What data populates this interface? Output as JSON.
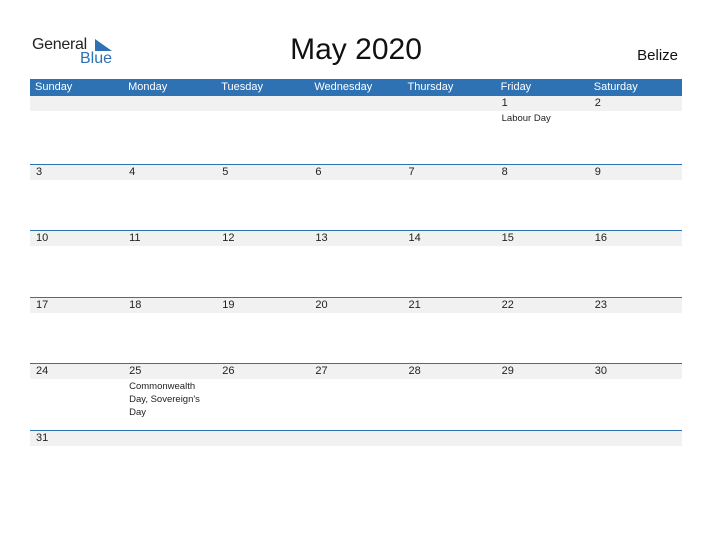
{
  "logo": {
    "line1": "General",
    "line2": "Blue",
    "color": "#2e72b4"
  },
  "title": "May 2020",
  "country": "Belize",
  "weekdays": [
    "Sunday",
    "Monday",
    "Tuesday",
    "Wednesday",
    "Thursday",
    "Friday",
    "Saturday"
  ],
  "weeks": [
    [
      {
        "d": ""
      },
      {
        "d": ""
      },
      {
        "d": ""
      },
      {
        "d": ""
      },
      {
        "d": ""
      },
      {
        "d": "1",
        "h": "Labour Day"
      },
      {
        "d": "2"
      }
    ],
    [
      {
        "d": "3"
      },
      {
        "d": "4"
      },
      {
        "d": "5"
      },
      {
        "d": "6"
      },
      {
        "d": "7"
      },
      {
        "d": "8"
      },
      {
        "d": "9"
      }
    ],
    [
      {
        "d": "10"
      },
      {
        "d": "11"
      },
      {
        "d": "12"
      },
      {
        "d": "13"
      },
      {
        "d": "14"
      },
      {
        "d": "15"
      },
      {
        "d": "16"
      }
    ],
    [
      {
        "d": "17"
      },
      {
        "d": "18"
      },
      {
        "d": "19"
      },
      {
        "d": "20"
      },
      {
        "d": "21"
      },
      {
        "d": "22"
      },
      {
        "d": "23"
      }
    ],
    [
      {
        "d": "24"
      },
      {
        "d": "25",
        "h": "Commonwealth Day, Sovereign's Day"
      },
      {
        "d": "26"
      },
      {
        "d": "27"
      },
      {
        "d": "28"
      },
      {
        "d": "29"
      },
      {
        "d": "30"
      }
    ],
    [
      {
        "d": "31"
      },
      {
        "d": ""
      },
      {
        "d": ""
      },
      {
        "d": ""
      },
      {
        "d": ""
      },
      {
        "d": ""
      },
      {
        "d": ""
      }
    ]
  ]
}
